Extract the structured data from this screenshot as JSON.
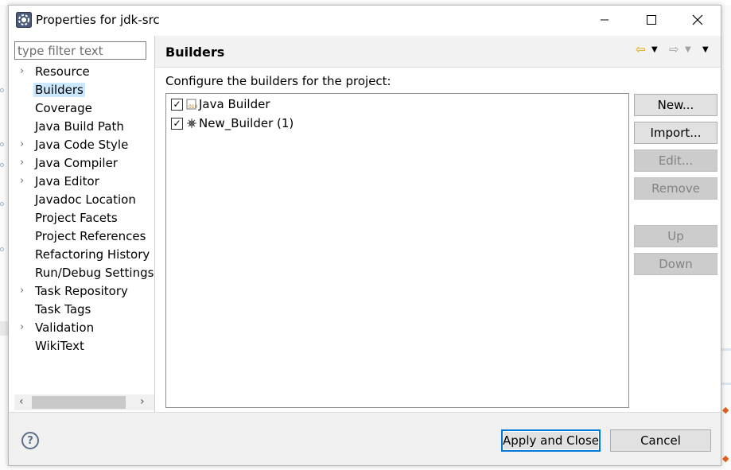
{
  "window": {
    "title": "Properties for jdk-src"
  },
  "filter": {
    "placeholder": "type filter text"
  },
  "nav": {
    "items": [
      {
        "label": "Resource",
        "expandable": true,
        "selected": false
      },
      {
        "label": "Builders",
        "expandable": false,
        "selected": true
      },
      {
        "label": "Coverage",
        "expandable": false,
        "selected": false
      },
      {
        "label": "Java Build Path",
        "expandable": false,
        "selected": false
      },
      {
        "label": "Java Code Style",
        "expandable": true,
        "selected": false
      },
      {
        "label": "Java Compiler",
        "expandable": true,
        "selected": false
      },
      {
        "label": "Java Editor",
        "expandable": true,
        "selected": false
      },
      {
        "label": "Javadoc Location",
        "expandable": false,
        "selected": false
      },
      {
        "label": "Project Facets",
        "expandable": false,
        "selected": false
      },
      {
        "label": "Project References",
        "expandable": false,
        "selected": false
      },
      {
        "label": "Refactoring History",
        "expandable": false,
        "selected": false
      },
      {
        "label": "Run/Debug Settings",
        "expandable": false,
        "selected": false
      },
      {
        "label": "Task Repository",
        "expandable": true,
        "selected": false
      },
      {
        "label": "Task Tags",
        "expandable": false,
        "selected": false
      },
      {
        "label": "Validation",
        "expandable": true,
        "selected": false
      },
      {
        "label": "WikiText",
        "expandable": false,
        "selected": false
      }
    ]
  },
  "page": {
    "title": "Builders",
    "description": "Configure the builders for the project:",
    "builders": [
      {
        "label": "Java Builder",
        "checked": true,
        "icon": "java-builder-icon"
      },
      {
        "label": "New_Builder (1)",
        "checked": true,
        "icon": "external-builder-icon"
      }
    ],
    "buttons": {
      "new": "New...",
      "import": "Import...",
      "edit": "Edit...",
      "remove": "Remove",
      "up": "Up",
      "down": "Down"
    }
  },
  "footer": {
    "apply_close": "Apply and Close",
    "cancel": "Cancel"
  },
  "colors": {
    "selection": "#cce8ff",
    "default_button_border": "#0078d7",
    "disabled_button": "#cccccc"
  }
}
